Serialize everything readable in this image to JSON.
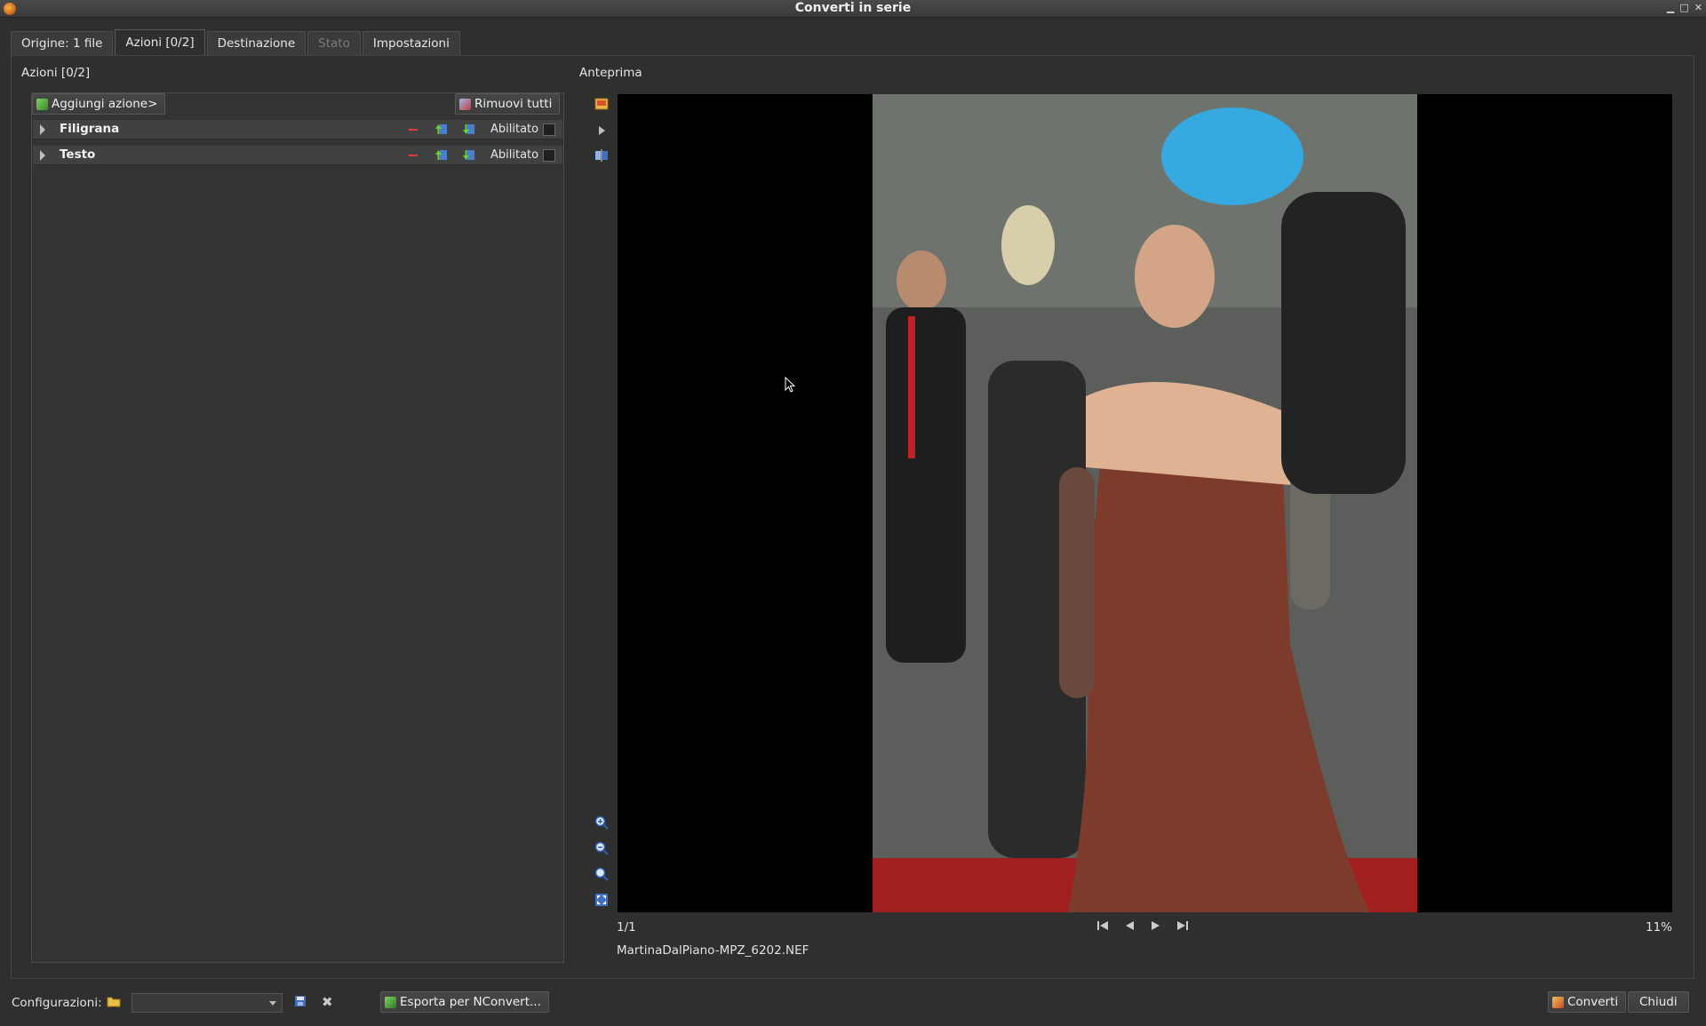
{
  "window": {
    "title": "Converti in serie"
  },
  "tabs": [
    {
      "label": "Origine: 1 file"
    },
    {
      "label": "Azioni [0/2]"
    },
    {
      "label": "Destinazione"
    },
    {
      "label": "Stato"
    },
    {
      "label": "Impostazioni"
    }
  ],
  "actions_panel": {
    "title": "Azioni [0/2]",
    "add_button": "Aggiungi azione>",
    "remove_all_button": "Rimuovi tutti",
    "items": [
      {
        "name": "Filigrana",
        "enabled_label": "Abilitato"
      },
      {
        "name": "Testo",
        "enabled_label": "Abilitato"
      }
    ]
  },
  "preview_panel": {
    "title": "Anteprima",
    "page_counter": "1/1",
    "zoom": "11%",
    "filename": "MartinaDalPiano-MPZ_6202.NEF"
  },
  "bottom": {
    "config_label": "Configurazioni:",
    "export_button": "Esporta per NConvert...",
    "convert_button": "Converti",
    "close_button": "Chiudi"
  }
}
